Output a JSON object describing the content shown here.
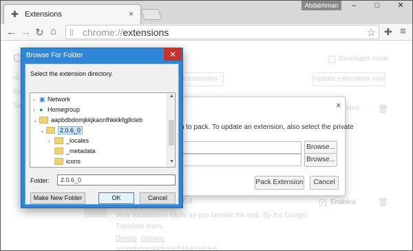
{
  "browser": {
    "tab_title": "Extensions",
    "tab_close": "×",
    "user_name": "Abdalrhman",
    "address_scheme": "chrome://",
    "address_path": "extensions",
    "window_minimize": "–",
    "window_maximize": "□",
    "window_close": "✕"
  },
  "extensions_page": {
    "heading_partial": "Cl",
    "sidebar_partial_1": "Hi",
    "sidebar_partial_2": "Ext",
    "sidebar_partial_3": "Se",
    "developer_mode_label": "Developer mode",
    "load_button_partial": "ck extension...",
    "update_button": "Update extensions now",
    "enabled_partial_1": "nled",
    "enabled_label": "Enabled",
    "ext_version": ".0.6",
    "ext_desc_line1": "View translations easily as you browse the web. By the Google",
    "ext_desc_line2": "Translate team.",
    "details_link": "Details",
    "options_link": "Options",
    "ext_id_partial": "aapbdbdomjkkjkaonfhkkikfgjllcleb"
  },
  "pack_dialog": {
    "text_line1": "n to pack. To update an extension, also select the private",
    "text_line2": "",
    "browse1": "Browse...",
    "browse2": "Browse...",
    "pack_button": "Pack Extension",
    "cancel_button": "Cancel",
    "close": "×"
  },
  "browse_dialog": {
    "title": "Browse For Folder",
    "close": "✕",
    "instruction": "Select the extension directory.",
    "tree": [
      {
        "label": "Network"
      },
      {
        "label": "Homegroup"
      },
      {
        "label": "aapbdbdomjkkjkaonfhkkikfgjllcleb"
      },
      {
        "label": "2.0.6_0"
      },
      {
        "label": "_locales"
      },
      {
        "label": "_metadata"
      },
      {
        "label": "icons"
      }
    ],
    "folder_label": "Folder:",
    "folder_value": "2.0.6_0",
    "make_new_folder": "Make New Folder",
    "ok": "OK",
    "cancel": "Cancel"
  }
}
